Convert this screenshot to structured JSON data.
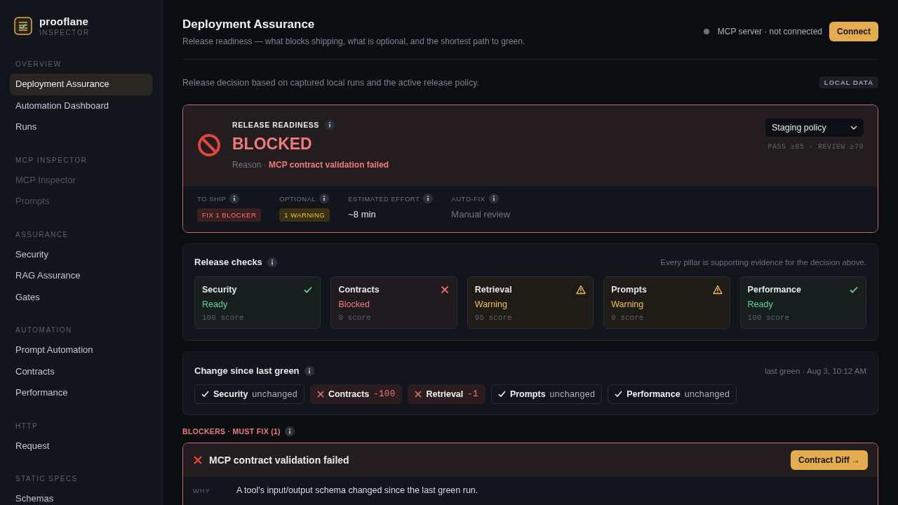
{
  "brand": {
    "name": "prooflane",
    "subtitle": "INSPECTOR"
  },
  "sidebar": {
    "sections": [
      {
        "title": "OVERVIEW",
        "items": [
          {
            "label": "Deployment Assurance",
            "selected": true,
            "disabled": false
          },
          {
            "label": "Automation Dashboard",
            "selected": false,
            "disabled": false
          },
          {
            "label": "Runs",
            "selected": false,
            "disabled": false
          }
        ]
      },
      {
        "title": "MCP INSPECTOR",
        "items": [
          {
            "label": "MCP Inspector",
            "selected": false,
            "disabled": true
          },
          {
            "label": "Prompts",
            "selected": false,
            "disabled": true
          }
        ]
      },
      {
        "title": "ASSURANCE",
        "items": [
          {
            "label": "Security",
            "selected": false,
            "disabled": false
          },
          {
            "label": "RAG Assurance",
            "selected": false,
            "disabled": false
          },
          {
            "label": "Gates",
            "selected": false,
            "disabled": false
          }
        ]
      },
      {
        "title": "AUTOMATION",
        "items": [
          {
            "label": "Prompt Automation",
            "selected": false,
            "disabled": false
          },
          {
            "label": "Contracts",
            "selected": false,
            "disabled": false
          },
          {
            "label": "Performance",
            "selected": false,
            "disabled": false
          }
        ]
      },
      {
        "title": "HTTP",
        "items": [
          {
            "label": "Request",
            "selected": false,
            "disabled": false
          }
        ]
      },
      {
        "title": "STATIC SPECS",
        "items": [
          {
            "label": "Schemas",
            "selected": false,
            "disabled": false
          }
        ]
      }
    ]
  },
  "header": {
    "title": "Deployment Assurance",
    "subtitle": "Release readiness — what blocks shipping, what is optional, and the shortest path to green.",
    "server_status": "MCP server · not connected",
    "connected": false,
    "connect_button": "Connect"
  },
  "decision_note": "Release decision based on captured local runs and the active release policy.",
  "data_badge": "LOCAL DATA",
  "readiness": {
    "label": "RELEASE READINESS",
    "blocked": true,
    "status": "BLOCKED",
    "reason_label": "Reason ·",
    "reason": "MCP contract validation failed",
    "policy": "Staging policy",
    "thresholds": "PASS ≥85 · REVIEW ≥70",
    "metrics": [
      {
        "label": "TO SHIP",
        "kind": "danger",
        "value": "FIX 1 BLOCKER"
      },
      {
        "label": "OPTIONAL",
        "kind": "warning",
        "value": "1 WARNING"
      },
      {
        "label": "ESTIMATED EFFORT",
        "kind": "text",
        "value": "~8 min"
      },
      {
        "label": "AUTO-FIX",
        "kind": "muted",
        "value": "Manual review"
      }
    ]
  },
  "checks": {
    "title": "Release checks",
    "note": "Every pillar is supporting evidence for the decision above.",
    "pillars": [
      {
        "name": "Security",
        "kind": "ready",
        "status_label": "Ready",
        "score": "100 score"
      },
      {
        "name": "Contracts",
        "kind": "blocked",
        "status_label": "Blocked",
        "score": "0 score"
      },
      {
        "name": "Retrieval",
        "kind": "warning",
        "status_label": "Warning",
        "score": "95 score"
      },
      {
        "name": "Prompts",
        "kind": "warning",
        "status_label": "Warning",
        "score": "0 score"
      },
      {
        "name": "Performance",
        "kind": "ready",
        "status_label": "Ready",
        "score": "100 score"
      }
    ]
  },
  "change": {
    "title": "Change since last green",
    "last_green": "last green · Aug 3, 10:12 AM",
    "items": [
      {
        "name": "Security",
        "delta": "unchanged",
        "regressed": false
      },
      {
        "name": "Contracts",
        "delta": "-100",
        "regressed": true
      },
      {
        "name": "Retrieval",
        "delta": "-1",
        "regressed": true
      },
      {
        "name": "Prompts",
        "delta": "unchanged",
        "regressed": false
      },
      {
        "name": "Performance",
        "delta": "unchanged",
        "regressed": false
      }
    ]
  },
  "blockers": {
    "heading": "BLOCKERS · MUST FIX (1)",
    "items": [
      {
        "title": "MCP contract validation failed",
        "action": "Contract Diff →",
        "details": [
          {
            "label": "WHY",
            "text": "A tool's input/output schema changed since the last green run."
          }
        ]
      }
    ]
  }
}
